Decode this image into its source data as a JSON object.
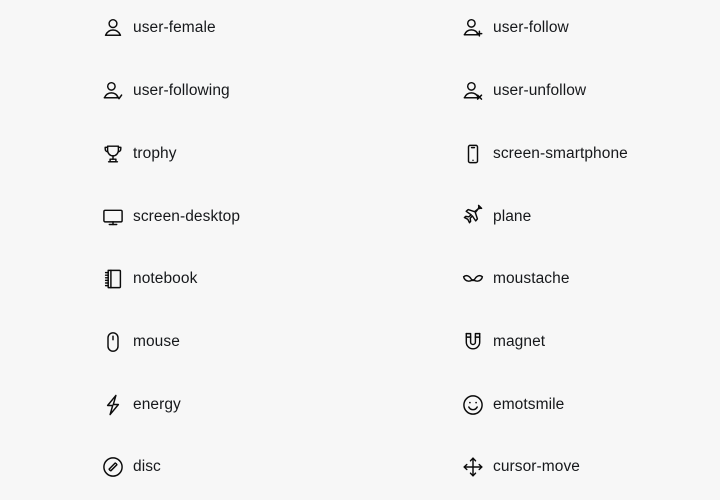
{
  "page": {
    "background_color": "#f7f7f7",
    "text_color": "#16181b",
    "icon_color": "#0b0b0b",
    "columns": 2,
    "rows": 8,
    "total_icons": 16
  },
  "icons": [
    {
      "name": "user-female",
      "label": "user-female",
      "glyph": "user-female-icon",
      "column": "left",
      "row": 1
    },
    {
      "name": "user-follow",
      "label": "user-follow",
      "glyph": "user-follow-icon",
      "column": "right",
      "row": 1
    },
    {
      "name": "user-following",
      "label": "user-following",
      "glyph": "user-following-icon",
      "column": "left",
      "row": 2
    },
    {
      "name": "user-unfollow",
      "label": "user-unfollow",
      "glyph": "user-unfollow-icon",
      "column": "right",
      "row": 2
    },
    {
      "name": "trophy",
      "label": "trophy",
      "glyph": "trophy-icon",
      "column": "left",
      "row": 3
    },
    {
      "name": "screen-smartphone",
      "label": "screen-smartphone",
      "glyph": "screen-smartphone-icon",
      "column": "right",
      "row": 3
    },
    {
      "name": "screen-desktop",
      "label": "screen-desktop",
      "glyph": "screen-desktop-icon",
      "column": "left",
      "row": 4
    },
    {
      "name": "plane",
      "label": "plane",
      "glyph": "plane-icon",
      "column": "right",
      "row": 4
    },
    {
      "name": "notebook",
      "label": "notebook",
      "glyph": "notebook-icon",
      "column": "left",
      "row": 5
    },
    {
      "name": "moustache",
      "label": "moustache",
      "glyph": "moustache-icon",
      "column": "right",
      "row": 5
    },
    {
      "name": "mouse",
      "label": "mouse",
      "glyph": "mouse-icon",
      "column": "left",
      "row": 6
    },
    {
      "name": "magnet",
      "label": "magnet",
      "glyph": "magnet-icon",
      "column": "right",
      "row": 6
    },
    {
      "name": "energy",
      "label": "energy",
      "glyph": "energy-icon",
      "column": "left",
      "row": 7
    },
    {
      "name": "emotsmile",
      "label": "emotsmile",
      "glyph": "emotsmile-icon",
      "column": "right",
      "row": 7
    },
    {
      "name": "disc",
      "label": "disc",
      "glyph": "disc-icon",
      "column": "left",
      "row": 8
    },
    {
      "name": "cursor-move",
      "label": "cursor-move",
      "glyph": "cursor-move-icon",
      "column": "right",
      "row": 8
    }
  ]
}
